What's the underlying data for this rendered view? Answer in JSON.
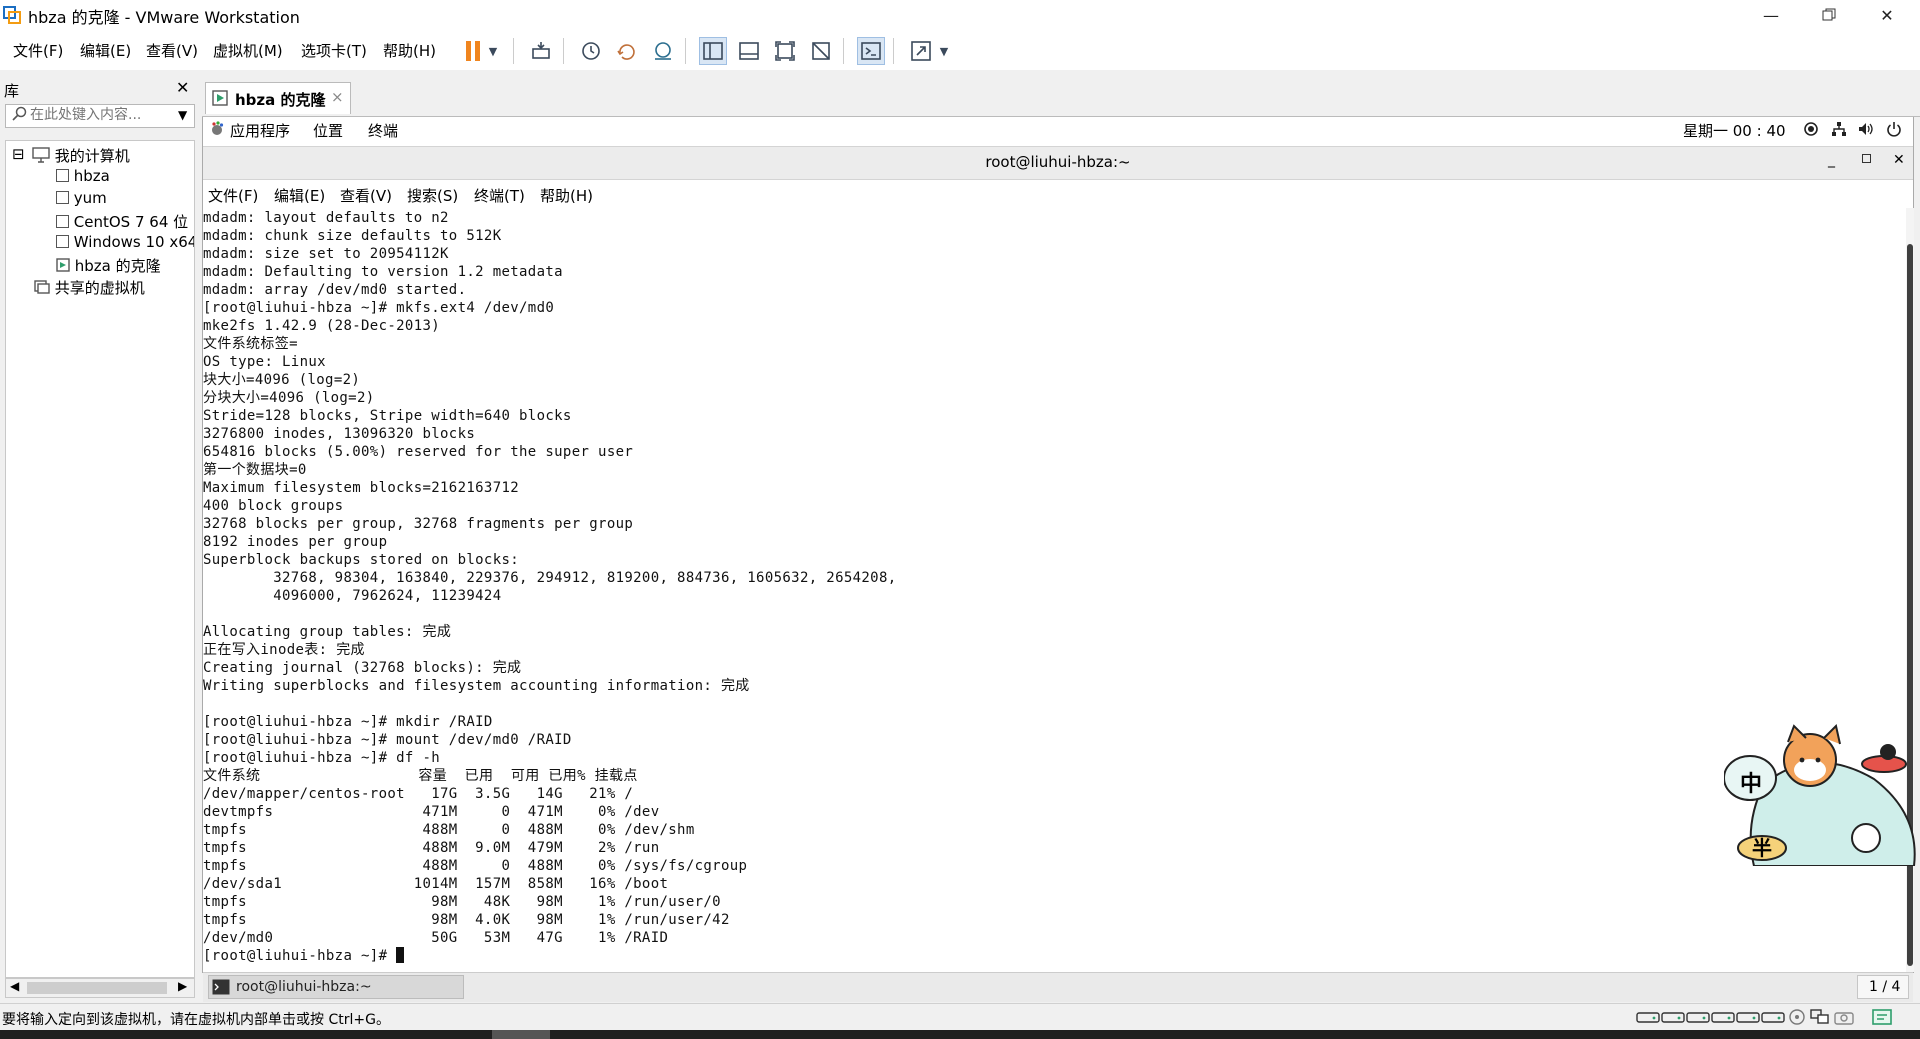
{
  "window": {
    "title": "hbza 的克隆 - VMware Workstation"
  },
  "menu": [
    "文件(F)",
    "编辑(E)",
    "查看(V)",
    "虚拟机(M)",
    "选项卡(T)",
    "帮助(H)"
  ],
  "toolbar_icons": [
    "pause-icon",
    "dropdown-icon",
    "send-keys-icon",
    "snapshot-icon",
    "revert-snapshot-icon",
    "snapshot-manager-icon",
    "show-library-icon",
    "show-thumbnail-icon",
    "full-screen-icon",
    "unity-icon",
    "console-icon",
    "stretch-icon",
    "stretch-dropdown-icon"
  ],
  "library": {
    "title": "库",
    "search_placeholder": "在此处键入内容...",
    "tree": [
      {
        "label": "我的计算机",
        "expander": "⊟"
      },
      {
        "label": "hbza"
      },
      {
        "label": "yum"
      },
      {
        "label": "CentOS 7 64 位"
      },
      {
        "label": "Windows 10 x64"
      },
      {
        "label": "hbza 的克隆"
      },
      {
        "label": "共享的虚拟机"
      }
    ]
  },
  "vm_tab": {
    "label": "hbza 的克隆",
    "close": "×"
  },
  "guest": {
    "menus": [
      "应用程序",
      "位置",
      "终端"
    ],
    "clock": "星期一 00 : 40"
  },
  "terminal": {
    "title": "root@liuhui-hbza:~",
    "menus": [
      "文件(F)",
      "编辑(E)",
      "查看(V)",
      "搜索(S)",
      "终端(T)",
      "帮助(H)"
    ],
    "lines": [
      "mdadm: layout defaults to n2",
      "mdadm: chunk size defaults to 512K",
      "mdadm: size set to 20954112K",
      "mdadm: Defaulting to version 1.2 metadata",
      "mdadm: array /dev/md0 started.",
      "[root@liuhui-hbza ~]# mkfs.ext4 /dev/md0",
      "mke2fs 1.42.9 (28-Dec-2013)",
      "文件系统标签=",
      "OS type: Linux",
      "块大小=4096 (log=2)",
      "分块大小=4096 (log=2)",
      "Stride=128 blocks, Stripe width=640 blocks",
      "3276800 inodes, 13096320 blocks",
      "654816 blocks (5.00%) reserved for the super user",
      "第一个数据块=0",
      "Maximum filesystem blocks=2162163712",
      "400 block groups",
      "32768 blocks per group, 32768 fragments per group",
      "8192 inodes per group",
      "Superblock backups stored on blocks:",
      "        32768, 98304, 163840, 229376, 294912, 819200, 884736, 1605632, 2654208,",
      "        4096000, 7962624, 11239424",
      "",
      "Allocating group tables: 完成",
      "正在写入inode表: 完成",
      "Creating journal (32768 blocks): 完成",
      "Writing superblocks and filesystem accounting information: 完成",
      "",
      "[root@liuhui-hbza ~]# mkdir /RAID",
      "[root@liuhui-hbza ~]# mount /dev/md0 /RAID",
      "[root@liuhui-hbza ~]# df -h",
      "文件系统                  容量  已用  可用 已用% 挂载点",
      "/dev/mapper/centos-root   17G  3.5G   14G   21% /",
      "devtmpfs                 471M     0  471M    0% /dev",
      "tmpfs                    488M     0  488M    0% /dev/shm",
      "tmpfs                    488M  9.0M  479M    2% /run",
      "tmpfs                    488M     0  488M    0% /sys/fs/cgroup",
      "/dev/sda1               1014M  157M  858M   16% /boot",
      "tmpfs                     98M   48K   98M    1% /run/user/0",
      "tmpfs                     98M  4.0K   98M    1% /run/user/42",
      "/dev/md0                  50G   53M   47G    1% /RAID"
    ],
    "prompt": "[root@liuhui-hbza ~]# "
  },
  "taskbar": {
    "item": "root@liuhui-hbza:~",
    "workspace": "1 / 4"
  },
  "statusbar": {
    "message": "要将输入定向到该虚拟机，请在虚拟机内部单击或按 Ctrl+G。"
  },
  "ime_mascot": {
    "ime_label": "中",
    "width_label": "半"
  },
  "colors": {
    "pause": "#f0851e",
    "terminal_bg": "#ffffff",
    "terminal_fg": "#111111",
    "status_green": "#2e9e6c"
  }
}
